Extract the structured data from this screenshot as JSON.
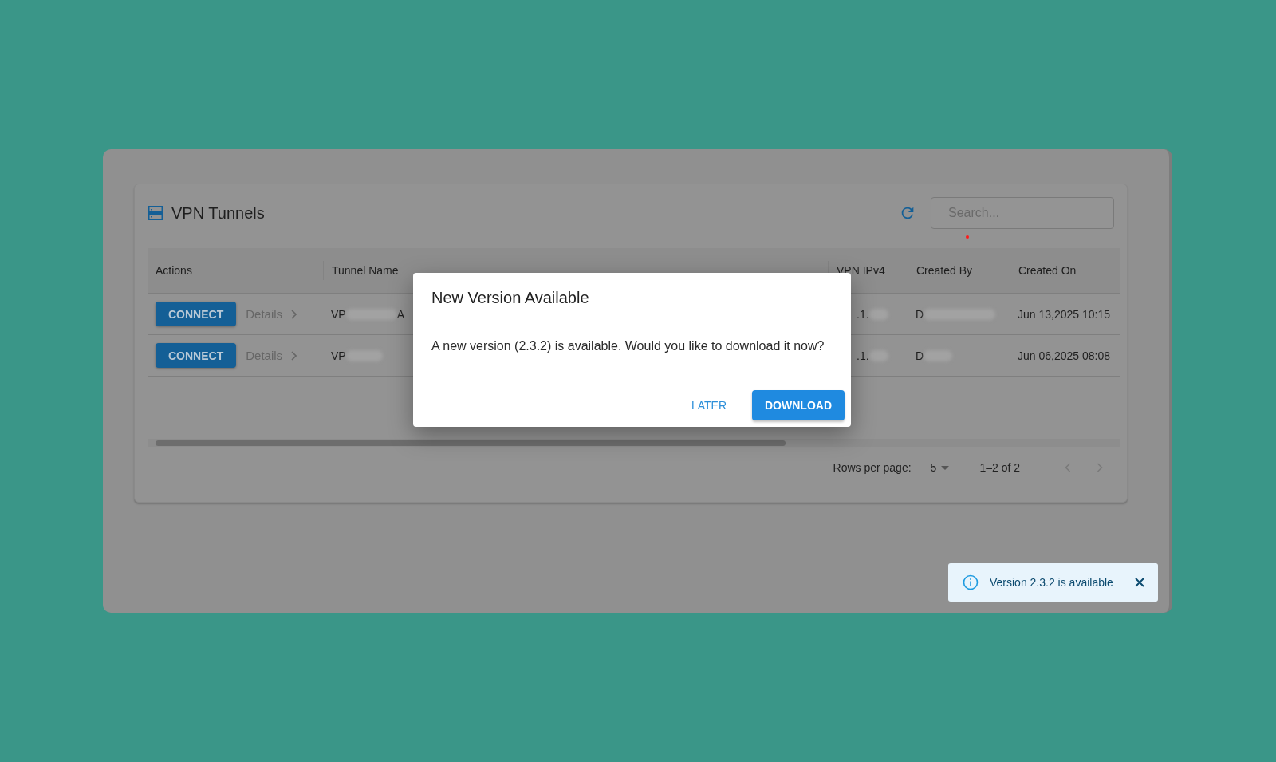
{
  "card": {
    "title": "VPN Tunnels",
    "search": {
      "placeholder": "Search..."
    }
  },
  "table": {
    "columns": [
      "Actions",
      "Tunnel Name",
      "VPN IPv4",
      "Created By",
      "Created On"
    ],
    "rows": [
      {
        "action": "CONNECT",
        "details": "Details",
        "tunnel_name": {
          "prefix": "VP",
          "suffix": "A"
        },
        "vpn_ipv4": {
          "prefix": ".1."
        },
        "created_by": {
          "prefix": "D"
        },
        "created_on": "Jun 13,2025 10:15"
      },
      {
        "action": "CONNECT",
        "details": "Details",
        "tunnel_name": {
          "prefix": "VP"
        },
        "vpn_ipv4": {
          "prefix": ".1."
        },
        "created_by": {
          "prefix": "D"
        },
        "created_on": "Jun 06,2025 08:08"
      }
    ]
  },
  "pagination": {
    "rows_per_page_label": "Rows per page:",
    "rows_per_page": "5",
    "range": "1–2 of 2"
  },
  "dialog": {
    "title": "New Version Available",
    "message": "A new version (2.3.2) is available. Would you like to download it now?",
    "buttons": [
      {
        "label": "LATER",
        "kind": "text"
      },
      {
        "label": "DOWNLOAD",
        "kind": "primary"
      }
    ]
  },
  "toast": {
    "message": "Version 2.3.2 is available"
  }
}
